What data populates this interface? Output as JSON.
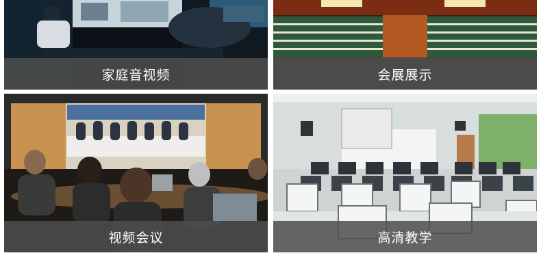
{
  "tiles": [
    {
      "id": "home-theater",
      "caption": "家庭音视频"
    },
    {
      "id": "exhibition",
      "caption": "会展展示"
    },
    {
      "id": "video-conference",
      "caption": "视频会议"
    },
    {
      "id": "teaching",
      "caption": "高清教学"
    }
  ]
}
